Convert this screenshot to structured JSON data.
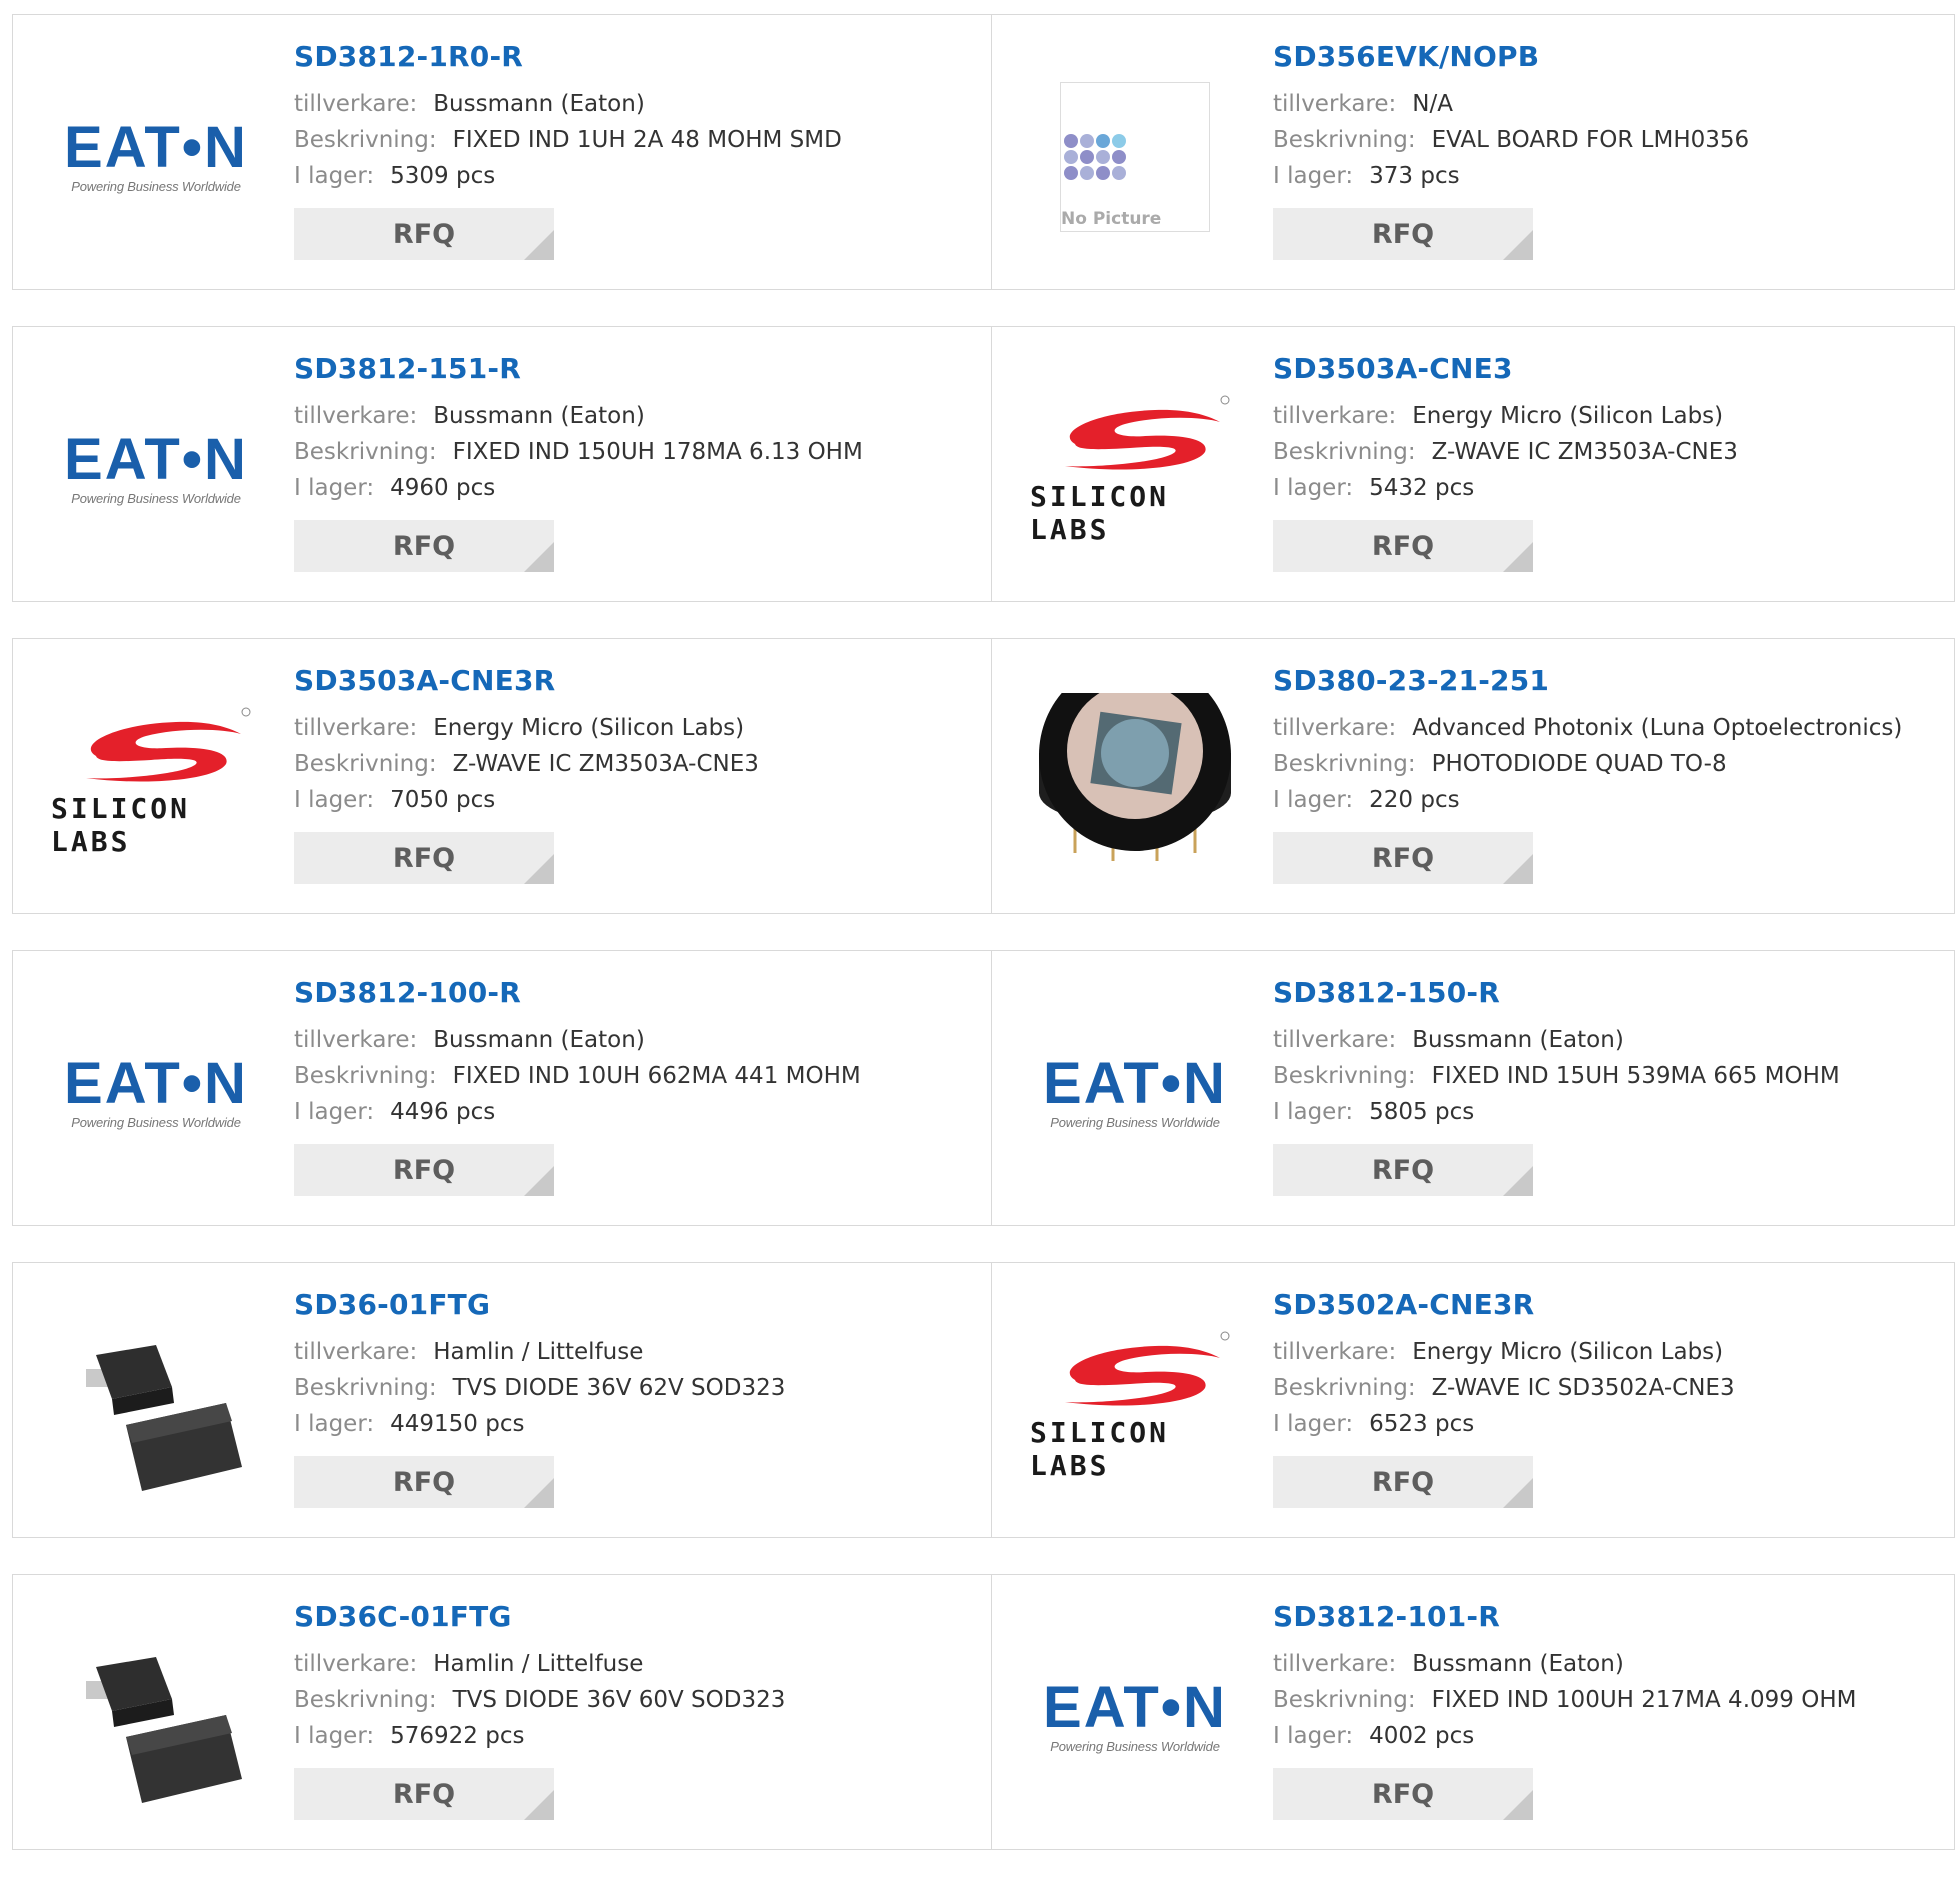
{
  "labels": {
    "manufacturer": "tillverkare:",
    "description": "Beskrivning:",
    "stock": "I lager:",
    "rfq": "RFQ"
  },
  "logo_text": {
    "eaton": "EAT•N",
    "eaton_tagline": "Powering Business Worldwide",
    "silabs": "SILICON LABS",
    "no_picture": "No Picture"
  },
  "colors": {
    "link": "#1568b8",
    "eaton_blue": "#1a5fab",
    "silabs_red": "#e4202a"
  },
  "products": [
    {
      "pn": "SD3812-1R0-R",
      "manufacturer": "Bussmann (Eaton)",
      "description": "FIXED IND 1UH 2A 48 MOHM SMD",
      "stock": "5309 pcs",
      "logo": "eaton"
    },
    {
      "pn": "SD356EVK/NOPB",
      "manufacturer": "N/A",
      "description": "EVAL BOARD FOR LMH0356",
      "stock": "373 pcs",
      "logo": "nopicture"
    },
    {
      "pn": "SD3812-151-R",
      "manufacturer": "Bussmann (Eaton)",
      "description": "FIXED IND 150UH 178MA 6.13 OHM",
      "stock": "4960 pcs",
      "logo": "eaton"
    },
    {
      "pn": "SD3503A-CNE3",
      "manufacturer": "Energy Micro (Silicon Labs)",
      "description": "Z-WAVE IC ZM3503A-CNE3",
      "stock": "5432 pcs",
      "logo": "silabs"
    },
    {
      "pn": "SD3503A-CNE3R",
      "manufacturer": "Energy Micro (Silicon Labs)",
      "description": "Z-WAVE IC ZM3503A-CNE3",
      "stock": "7050 pcs",
      "logo": "silabs"
    },
    {
      "pn": "SD380-23-21-251",
      "manufacturer": "Advanced Photonix (Luna Optoelectronics)",
      "description": "PHOTODIODE QUAD TO-8",
      "stock": "220 pcs",
      "logo": "photodiode"
    },
    {
      "pn": "SD3812-100-R",
      "manufacturer": "Bussmann (Eaton)",
      "description": "FIXED IND 10UH 662MA 441 MOHM",
      "stock": "4496 pcs",
      "logo": "eaton"
    },
    {
      "pn": "SD3812-150-R",
      "manufacturer": "Bussmann (Eaton)",
      "description": "FIXED IND 15UH 539MA 665 MOHM",
      "stock": "5805 pcs",
      "logo": "eaton"
    },
    {
      "pn": "SD36-01FTG",
      "manufacturer": "Hamlin / Littelfuse",
      "description": "TVS DIODE 36V 62V SOD323",
      "stock": "449150 pcs",
      "logo": "diode"
    },
    {
      "pn": "SD3502A-CNE3R",
      "manufacturer": "Energy Micro (Silicon Labs)",
      "description": "Z-WAVE IC SD3502A-CNE3",
      "stock": "6523 pcs",
      "logo": "silabs"
    },
    {
      "pn": "SD36C-01FTG",
      "manufacturer": "Hamlin / Littelfuse",
      "description": "TVS DIODE 36V 60V SOD323",
      "stock": "576922 pcs",
      "logo": "diode"
    },
    {
      "pn": "SD3812-101-R",
      "manufacturer": "Bussmann (Eaton)",
      "description": "FIXED IND 100UH 217MA 4.099 OHM",
      "stock": "4002 pcs",
      "logo": "eaton"
    }
  ]
}
